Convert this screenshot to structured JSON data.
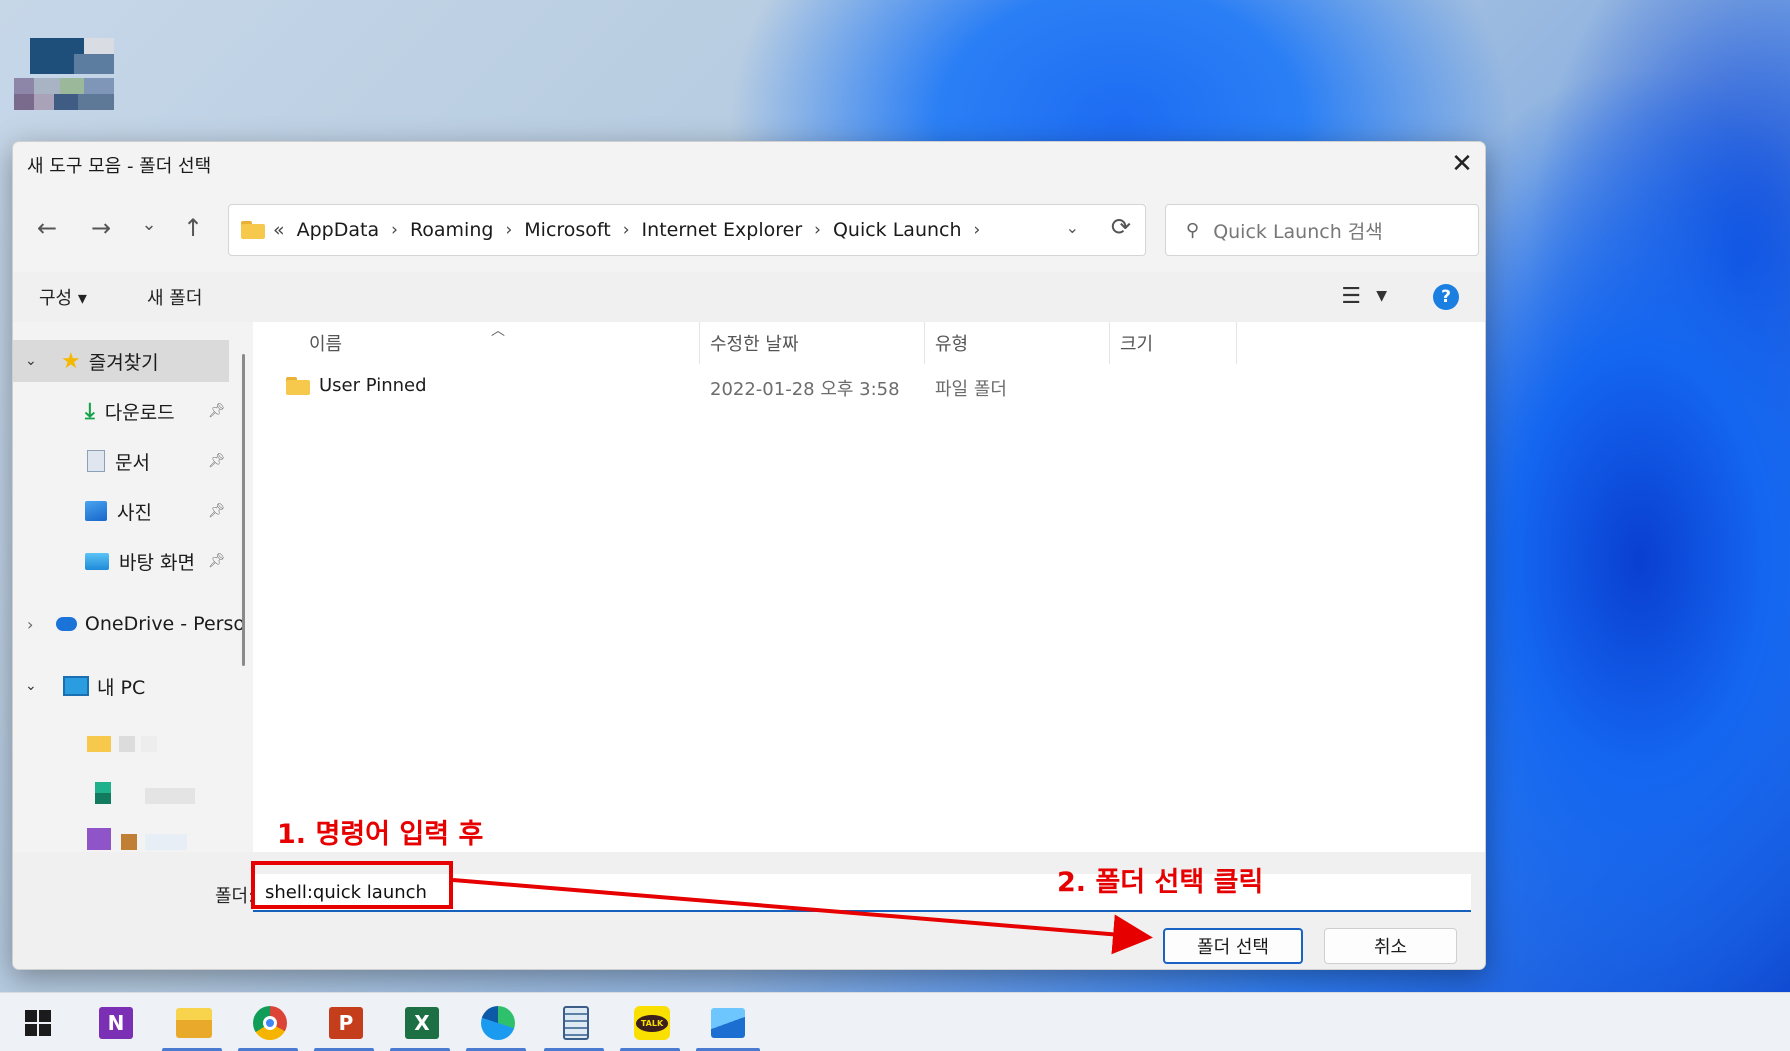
{
  "window": {
    "title": "새 도구 모음 - 폴더 선택",
    "close_glyph": "✕"
  },
  "nav": {
    "back": "←",
    "forward": "→",
    "recent": "⌄",
    "up": "↑"
  },
  "address": {
    "overflow": "«",
    "crumbs": [
      "AppData",
      "Roaming",
      "Microsoft",
      "Internet Explorer",
      "Quick Launch"
    ],
    "separator": "›"
  },
  "search": {
    "placeholder": "Quick Launch 검색"
  },
  "toolbar": {
    "organize": "구성 ▾",
    "new_folder": "새 폴더"
  },
  "sidebar": {
    "items": [
      {
        "label": "즐겨찾기",
        "icon": "star-icon",
        "selected": true
      },
      {
        "label": "다운로드",
        "icon": "download-icon",
        "pinned": true
      },
      {
        "label": "문서",
        "icon": "document-icon",
        "pinned": true
      },
      {
        "label": "사진",
        "icon": "picture-icon",
        "pinned": true
      },
      {
        "label": "바탕 화면",
        "icon": "desktop-icon",
        "pinned": true
      },
      {
        "label": "OneDrive - Perso",
        "icon": "cloud-icon"
      },
      {
        "label": "내 PC",
        "icon": "monitor-icon"
      }
    ]
  },
  "file_list": {
    "columns": [
      "이름",
      "수정한 날짜",
      "유형",
      "크기"
    ],
    "rows": [
      {
        "name": "User Pinned",
        "modified": "2022-01-28 오후 3:58",
        "type": "파일 폴더",
        "size": ""
      }
    ]
  },
  "bottom": {
    "folder_label": "폴더:",
    "folder_value": "shell:quick launch",
    "select_button": "폴더 선택",
    "cancel_button": "취소"
  },
  "annotations": {
    "step1": "1. 명령어 입력 후",
    "step2": "2. 폴더 선택 클릭",
    "color": "#e60000"
  },
  "taskbar": {
    "apps": [
      "start-icon",
      "onenote-icon",
      "file-explorer-icon",
      "chrome-icon",
      "powerpoint-icon",
      "excel-icon",
      "edge-icon",
      "notepad-icon",
      "kakaotalk-icon",
      "photos-icon"
    ],
    "kakao_badge": "TALK"
  }
}
